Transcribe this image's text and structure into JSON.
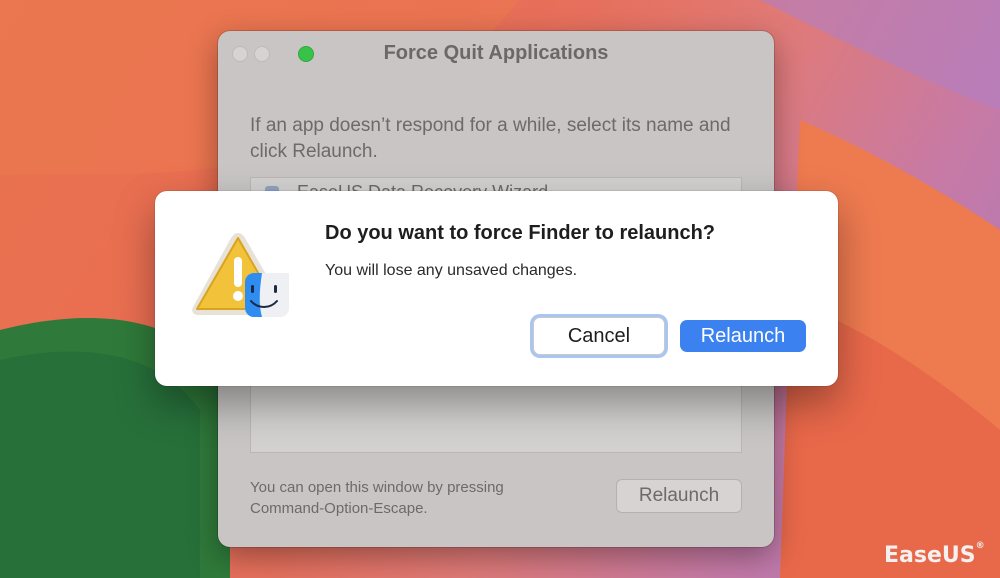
{
  "force_quit_window": {
    "title": "Force Quit Applications",
    "description": "If an app doesn’t respond for a while, select its name and click Relaunch.",
    "list_item_partial": "EaseUS Data Recovery Wizard",
    "hint": "You can open this window by pressing Command-Option-Escape.",
    "relaunch_label": "Relaunch"
  },
  "alert": {
    "title": "Do you want to force Finder to relaunch?",
    "message": "You will lose any unsaved changes.",
    "cancel_label": "Cancel",
    "relaunch_label": "Relaunch"
  },
  "watermark": {
    "text": "EaseUS",
    "mark": "®"
  },
  "colors": {
    "accent": "#3b82f0",
    "focus_ring": "#a9c6f2",
    "warning_yellow": "#f1c23a"
  }
}
